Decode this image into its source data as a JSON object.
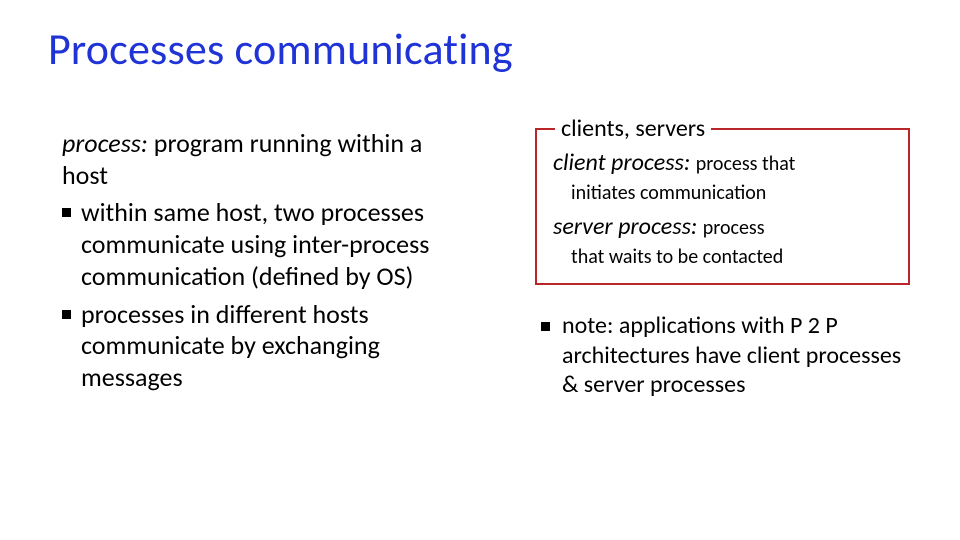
{
  "title": "Processes communicating",
  "left": {
    "def_term": "process:",
    "def_body": "program running within a host",
    "bullets": [
      "within same host, two processes communicate using  inter-process communication (defined by OS)",
      "processes in different hosts communicate by exchanging messages"
    ]
  },
  "right": {
    "legend": "clients, servers",
    "client_term": "client process:",
    "client_desc_inline": "process that",
    "client_desc_block": "initiates communication",
    "server_term": "server process:",
    "server_desc_inline": "process",
    "server_desc_block": "that waits to be contacted",
    "note": "note: applications with P 2 P architectures have client processes & server processes"
  }
}
